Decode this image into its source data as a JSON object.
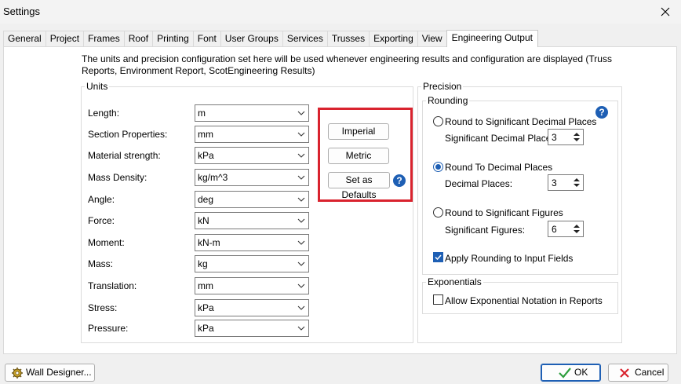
{
  "window": {
    "title": "Settings"
  },
  "tabs": [
    "General",
    "Project",
    "Frames",
    "Roof",
    "Printing",
    "Font",
    "User Groups",
    "Services",
    "Trusses",
    "Exporting",
    "View",
    "Engineering Output"
  ],
  "active_tab": "Engineering Output",
  "description": "The units and precision configuration set here will be used whenever engineering results and configuration are displayed (Truss Reports, Environment Report, ScotEngineering Results)",
  "units": {
    "group_label": "Units",
    "rows": [
      {
        "label": "Length:",
        "value": "m"
      },
      {
        "label": "Section Properties:",
        "value": "mm"
      },
      {
        "label": "Material strength:",
        "value": "kPa"
      },
      {
        "label": "Mass Density:",
        "value": "kg/m^3"
      },
      {
        "label": "Angle:",
        "value": "deg"
      },
      {
        "label": "Force:",
        "value": "kN"
      },
      {
        "label": "Moment:",
        "value": "kN-m"
      },
      {
        "label": "Mass:",
        "value": "kg"
      },
      {
        "label": "Translation:",
        "value": "mm"
      },
      {
        "label": "Stress:",
        "value": "kPa"
      },
      {
        "label": "Pressure:",
        "value": "kPa"
      }
    ],
    "buttons": {
      "imperial": "Imperial",
      "metric": "Metric",
      "set_defaults": "Set as Defaults"
    },
    "highlight_color": "#d9232e"
  },
  "precision": {
    "group_label": "Precision",
    "rounding": {
      "label": "Rounding",
      "options": [
        {
          "label": "Round to Significant Decimal Places",
          "sub_label": "Significant Decimal Places:",
          "value": "3",
          "selected": false
        },
        {
          "label": "Round To Decimal Places",
          "sub_label": "Decimal Places:",
          "value": "3",
          "selected": true
        },
        {
          "label": "Round to Significant Figures",
          "sub_label": "Significant Figures:",
          "value": "6",
          "selected": false
        }
      ],
      "apply_to_input": {
        "label": "Apply Rounding to Input Fields",
        "checked": true
      }
    },
    "exponentials": {
      "label": "Exponentials",
      "allow_notation": {
        "label": "Allow Exponential Notation in Reports",
        "checked": false
      }
    }
  },
  "footer": {
    "wall_designer": "Wall Designer...",
    "ok": "OK",
    "cancel": "Cancel"
  },
  "colors": {
    "accent": "#1e5fb4",
    "ok_check": "#2e9e3e",
    "cancel_x": "#d9232e"
  }
}
